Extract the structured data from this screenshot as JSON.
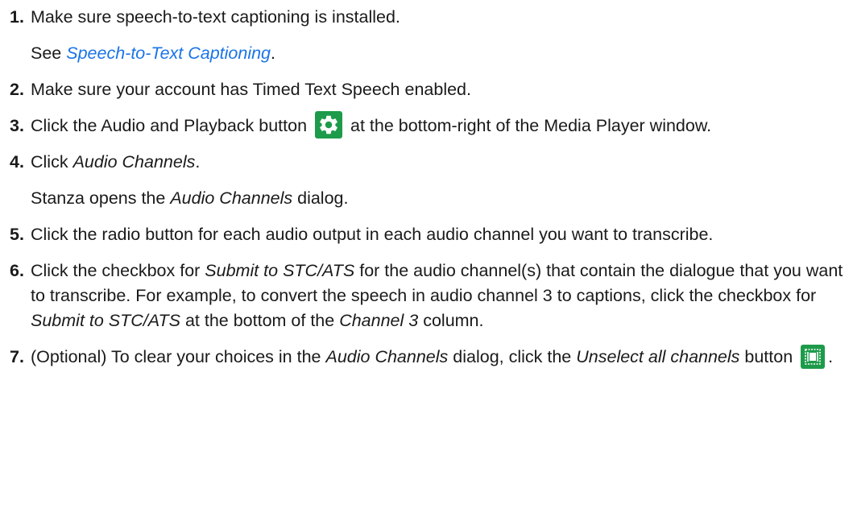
{
  "steps": [
    {
      "num": "1.",
      "text": "Make sure speech-to-text captioning is installed.",
      "sub_prefix": "See ",
      "sub_link": "Speech-to-Text Captioning",
      "sub_suffix": "."
    },
    {
      "num": "2.",
      "text": "Make sure your account has Timed Text Speech enabled."
    },
    {
      "num": "3.",
      "text_before": "Click the Audio and Playback button",
      "icon": "gear-icon",
      "text_after": "at the bottom-right of the Media Player window."
    },
    {
      "num": "4.",
      "text_before": "Click ",
      "em": "Audio Channels",
      "text_after": ".",
      "sub_before": "Stanza opens the ",
      "sub_em": "Audio Channels",
      "sub_after": " dialog."
    },
    {
      "num": "5.",
      "text": "Click the radio button for each audio output in each audio channel you want to transcribe."
    },
    {
      "num": "6.",
      "t1": "Click the checkbox for ",
      "e1": "Submit to STC/ATS",
      "t2": " for the audio channel(s) that contain the dialogue that you want to transcribe. For example, to convert the speech in audio channel 3 to captions, click the checkbox for ",
      "e2": "Submit to STC/ATS",
      "t3": " at the bottom of the ",
      "e3": "Channel 3",
      "t4": " column."
    },
    {
      "num": "7.",
      "t1": "(Optional) To clear your choices in the ",
      "e1": "Audio Channels",
      "t2": " dialog, click the ",
      "e2": "Unselect all channels",
      "t3": " button",
      "icon": "unselect-channels-icon",
      "t4": "."
    }
  ],
  "colors": {
    "link": "#1a73e8",
    "icon_bg": "#1d9b4a"
  }
}
